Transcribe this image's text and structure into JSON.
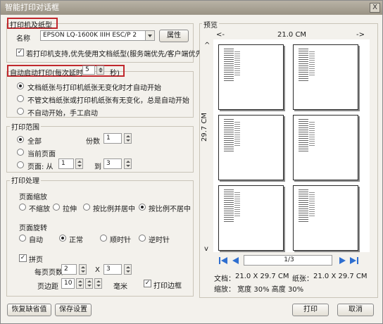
{
  "window": {
    "title": "智能打印对话框",
    "close_glyph": "X"
  },
  "printer": {
    "group_title": "打印机及纸型",
    "name_label": "名称",
    "name_value": "EPSON LQ-1600K IIIH ESC/P 2",
    "properties_button": "属性",
    "use_doc_paper_label": "若打印机支持,优先使用文档纸型(服务端优先/客户端优先)",
    "use_doc_paper_checked": true
  },
  "auto_start": {
    "group_title_prefix": "自动启动打印(每次延时",
    "delay_value": "5",
    "group_title_suffix": "秒)",
    "options": [
      {
        "label": "文档纸张与打印机纸张无变化时才自动开始",
        "selected": true
      },
      {
        "label": "不管文档纸张或打印机纸张有无变化，总是自动开始",
        "selected": false
      },
      {
        "label": "不自动开始，手工启动",
        "selected": false
      }
    ]
  },
  "print_range": {
    "group_title": "打印范围",
    "all_label": "全部",
    "all_selected": true,
    "copies_label": "份数",
    "copies_value": "1",
    "current_label": "当前页面",
    "pages_label": "页面: 从",
    "from_value": "1",
    "to_label": "到",
    "to_value": "3"
  },
  "processing": {
    "group_title": "打印处理",
    "scale_title": "页面缩放",
    "scale_options": [
      {
        "label": "不缩放",
        "selected": false
      },
      {
        "label": "拉伸",
        "selected": false
      },
      {
        "label": "按比例并居中",
        "selected": false
      },
      {
        "label": "按比例不居中",
        "selected": true
      }
    ],
    "rotate_title": "页面旋转",
    "rotate_options": [
      {
        "label": "自动",
        "selected": false
      },
      {
        "label": "正常",
        "selected": true
      },
      {
        "label": "顺时针",
        "selected": false
      },
      {
        "label": "逆时针",
        "selected": false
      }
    ],
    "combine_label": "拼页",
    "combine_checked": true,
    "per_page_label": "每页页数",
    "per_page_x": "2",
    "x_label": "X",
    "per_page_y": "3",
    "margin_label": "页边距",
    "margin_value": "10",
    "margin_unit": "毫米",
    "border_label": "打印边框",
    "border_checked": true
  },
  "preview": {
    "group_title": "预览",
    "width_left_arrow": "<-",
    "width_label": "21.0 CM",
    "width_right_arrow": "->",
    "top_arrow": "^",
    "height_label": "29.7 CM",
    "bottom_arrow": "v",
    "page_indicator": "1/3",
    "doc_label": "文档：",
    "doc_value": "21.0 X 29.7 CM",
    "paper_label": "纸张：",
    "paper_value": "21.0 X 29.7 CM",
    "scale_line": "缩放：  宽度 30%  高度 30%"
  },
  "footer": {
    "restore_button": "恢复缺省值",
    "save_button": "保存设置",
    "print_button": "打印",
    "cancel_button": "取消"
  },
  "colors": {
    "highlight_box": "#c0282d",
    "nav_arrow": "#2f6fd0",
    "titlebar": "#a59e90"
  },
  "icons": {
    "nav_first": "first-page-icon",
    "nav_prev": "prev-page-icon",
    "nav_next": "next-page-icon",
    "nav_last": "last-page-icon"
  }
}
